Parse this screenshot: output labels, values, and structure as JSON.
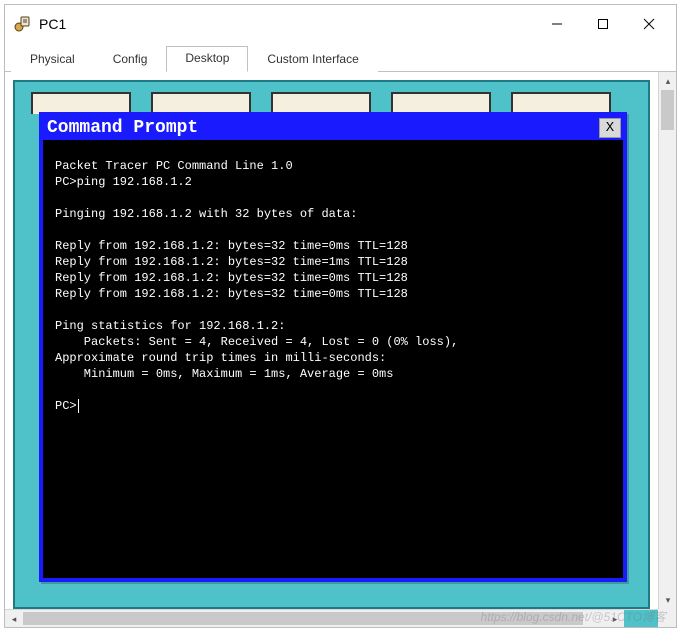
{
  "window": {
    "title": "PC1"
  },
  "tabs": [
    {
      "label": "Physical"
    },
    {
      "label": "Config"
    },
    {
      "label": "Desktop"
    },
    {
      "label": "Custom Interface"
    }
  ],
  "active_tab_index": 2,
  "cmd": {
    "title": "Command Prompt",
    "close_label": "X",
    "lines": [
      "Packet Tracer PC Command Line 1.0",
      "PC>ping 192.168.1.2",
      "",
      "Pinging 192.168.1.2 with 32 bytes of data:",
      "",
      "Reply from 192.168.1.2: bytes=32 time=0ms TTL=128",
      "Reply from 192.168.1.2: bytes=32 time=1ms TTL=128",
      "Reply from 192.168.1.2: bytes=32 time=0ms TTL=128",
      "Reply from 192.168.1.2: bytes=32 time=0ms TTL=128",
      "",
      "Ping statistics for 192.168.1.2:",
      "    Packets: Sent = 4, Received = 4, Lost = 0 (0% loss),",
      "Approximate round trip times in milli-seconds:",
      "    Minimum = 0ms, Maximum = 1ms, Average = 0ms",
      "",
      "PC>"
    ]
  },
  "watermark": "https://blog.csdn.net/@51CTO博客"
}
